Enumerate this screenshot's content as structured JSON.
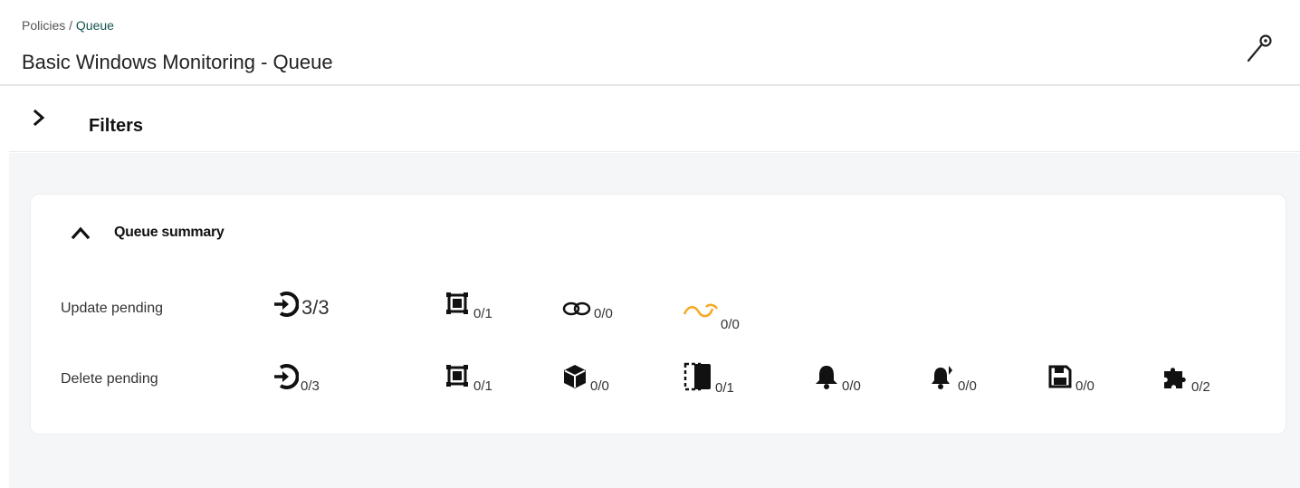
{
  "breadcrumb": {
    "parent": "Policies",
    "separator": "/",
    "current": "Queue"
  },
  "page_title": "Basic Windows Monitoring - Queue",
  "filters": {
    "label": "Filters",
    "expanded": false
  },
  "summary": {
    "title": "Queue summary",
    "expanded": true,
    "update_row": {
      "label": "Update pending",
      "items": [
        {
          "icon": "enter-icon",
          "value": "3/3"
        },
        {
          "icon": "module-icon",
          "value": "0/1"
        },
        {
          "icon": "links-icon",
          "value": "0/0"
        },
        {
          "icon": "links-orange-icon",
          "value": "0/0"
        }
      ]
    },
    "delete_row": {
      "label": "Delete pending",
      "items": [
        {
          "icon": "enter-icon",
          "value": "0/3"
        },
        {
          "icon": "module-icon",
          "value": "0/1"
        },
        {
          "icon": "cube-icon",
          "value": "0/0"
        },
        {
          "icon": "collection-icon",
          "value": "0/1"
        },
        {
          "icon": "bell-icon",
          "value": "0/0"
        },
        {
          "icon": "bell-action-icon",
          "value": "0/0"
        },
        {
          "icon": "floppy-icon",
          "value": "0/0"
        },
        {
          "icon": "puzzle-icon",
          "value": "0/2"
        }
      ]
    }
  },
  "colors": {
    "accent": "#14524f",
    "orange_icon": "#f7a822",
    "background": "#f5f6f8"
  }
}
